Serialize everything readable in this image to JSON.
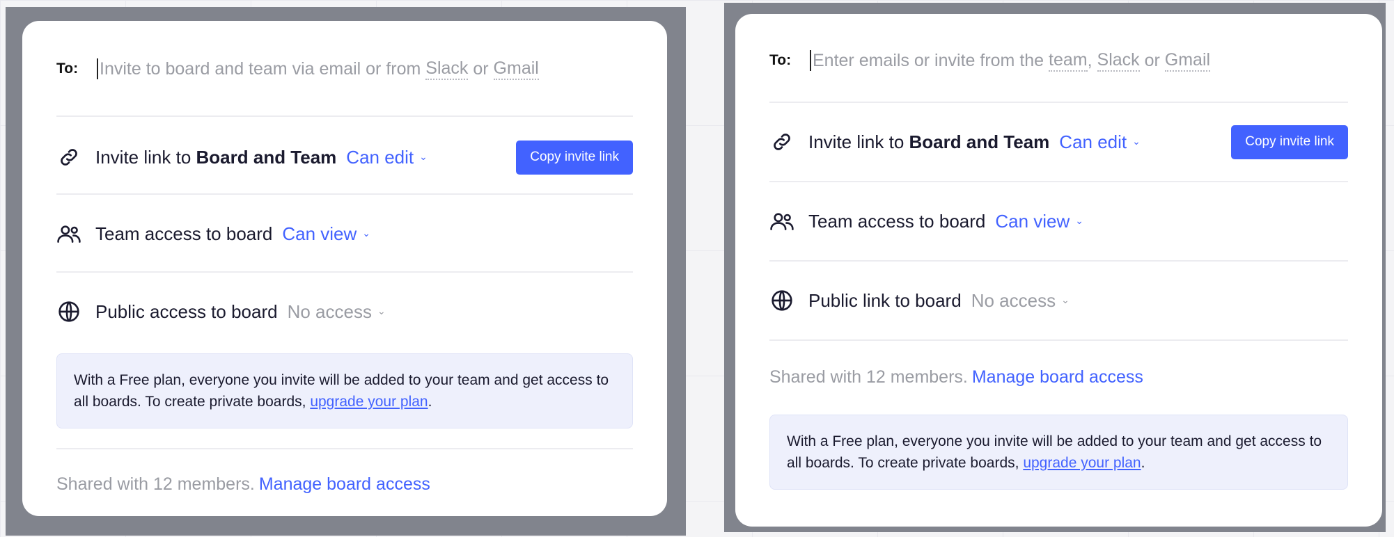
{
  "left_panel": {
    "to_label": "To:",
    "to_placeholder": {
      "prefix": "Invite to board and team via email or from ",
      "slack": "Slack",
      "mid": " or ",
      "gmail": "Gmail"
    },
    "invite_link": {
      "text": "Invite link to ",
      "bold": "Board and Team",
      "permission": "Can edit",
      "button": "Copy invite link"
    },
    "team_access": {
      "text": "Team access to board",
      "permission": "Can view"
    },
    "public_access": {
      "text": "Public access to board",
      "permission": "No access"
    },
    "info": {
      "text": "With a Free plan, everyone you invite will be added to your team and get access to all boards. To create private boards, ",
      "link": "upgrade your plan",
      "end": "."
    },
    "shared": {
      "text": "Shared with 12 members.",
      "link": "Manage board access"
    }
  },
  "right_panel": {
    "to_label": "To:",
    "to_placeholder": {
      "prefix": "Enter emails or invite from the ",
      "team": "team",
      "sep": ", ",
      "slack": "Slack",
      "mid": " or ",
      "gmail": "Gmail"
    },
    "invite_link": {
      "text": "Invite link to ",
      "bold": "Board and Team",
      "permission": "Can edit",
      "button": "Copy invite link"
    },
    "team_access": {
      "text": "Team access to board",
      "permission": "Can view"
    },
    "public_link": {
      "text": "Public link to board",
      "permission": "No access"
    },
    "shared": {
      "text": "Shared with 12 members.",
      "link": "Manage board access"
    },
    "info": {
      "text": "With a Free plan, everyone you invite will be added to your team and get access to all boards. To create private boards, ",
      "link": "upgrade your plan",
      "end": "."
    }
  },
  "icons": {
    "link": "link-icon",
    "team": "team-icon",
    "globe": "globe-icon",
    "chevron": "chevron-down-icon"
  },
  "colors": {
    "accent": "#4262ff",
    "frame": "#81848d",
    "info_bg": "#eef0fc",
    "muted": "#9a9ca3"
  }
}
